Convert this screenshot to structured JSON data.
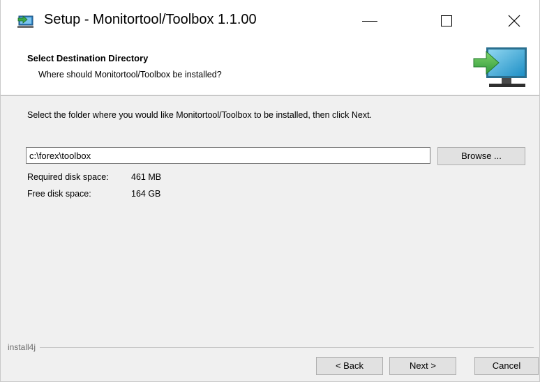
{
  "window": {
    "title": "Setup - Monitortool/Toolbox 1.1.00",
    "minimize_glyph": "—",
    "maximize_glyph": "☐",
    "close_glyph": "✕"
  },
  "header": {
    "title": "Select Destination Directory",
    "subtitle": "Where should Monitortool/Toolbox be installed?"
  },
  "main": {
    "instruction": "Select the folder where you would like Monitortool/Toolbox to be installed, then click Next.",
    "path_value": "c:\\forex\\toolbox",
    "browse_label": "Browse ...",
    "required_label": "Required disk space:",
    "required_value": "461 MB",
    "free_label": "Free disk space:",
    "free_value": "164 GB"
  },
  "footer": {
    "branding": "install4j",
    "back_label": "< Back",
    "next_label": "Next >",
    "cancel_label": "Cancel"
  },
  "colors": {
    "accent_green": "#3aa84a",
    "monitor_teal": "#31a8d3",
    "window_bg": "#f0f0f0"
  },
  "icons": {
    "app_icon": "install-arrow-icon",
    "header_graphic": "monitor-arrow-icon"
  }
}
